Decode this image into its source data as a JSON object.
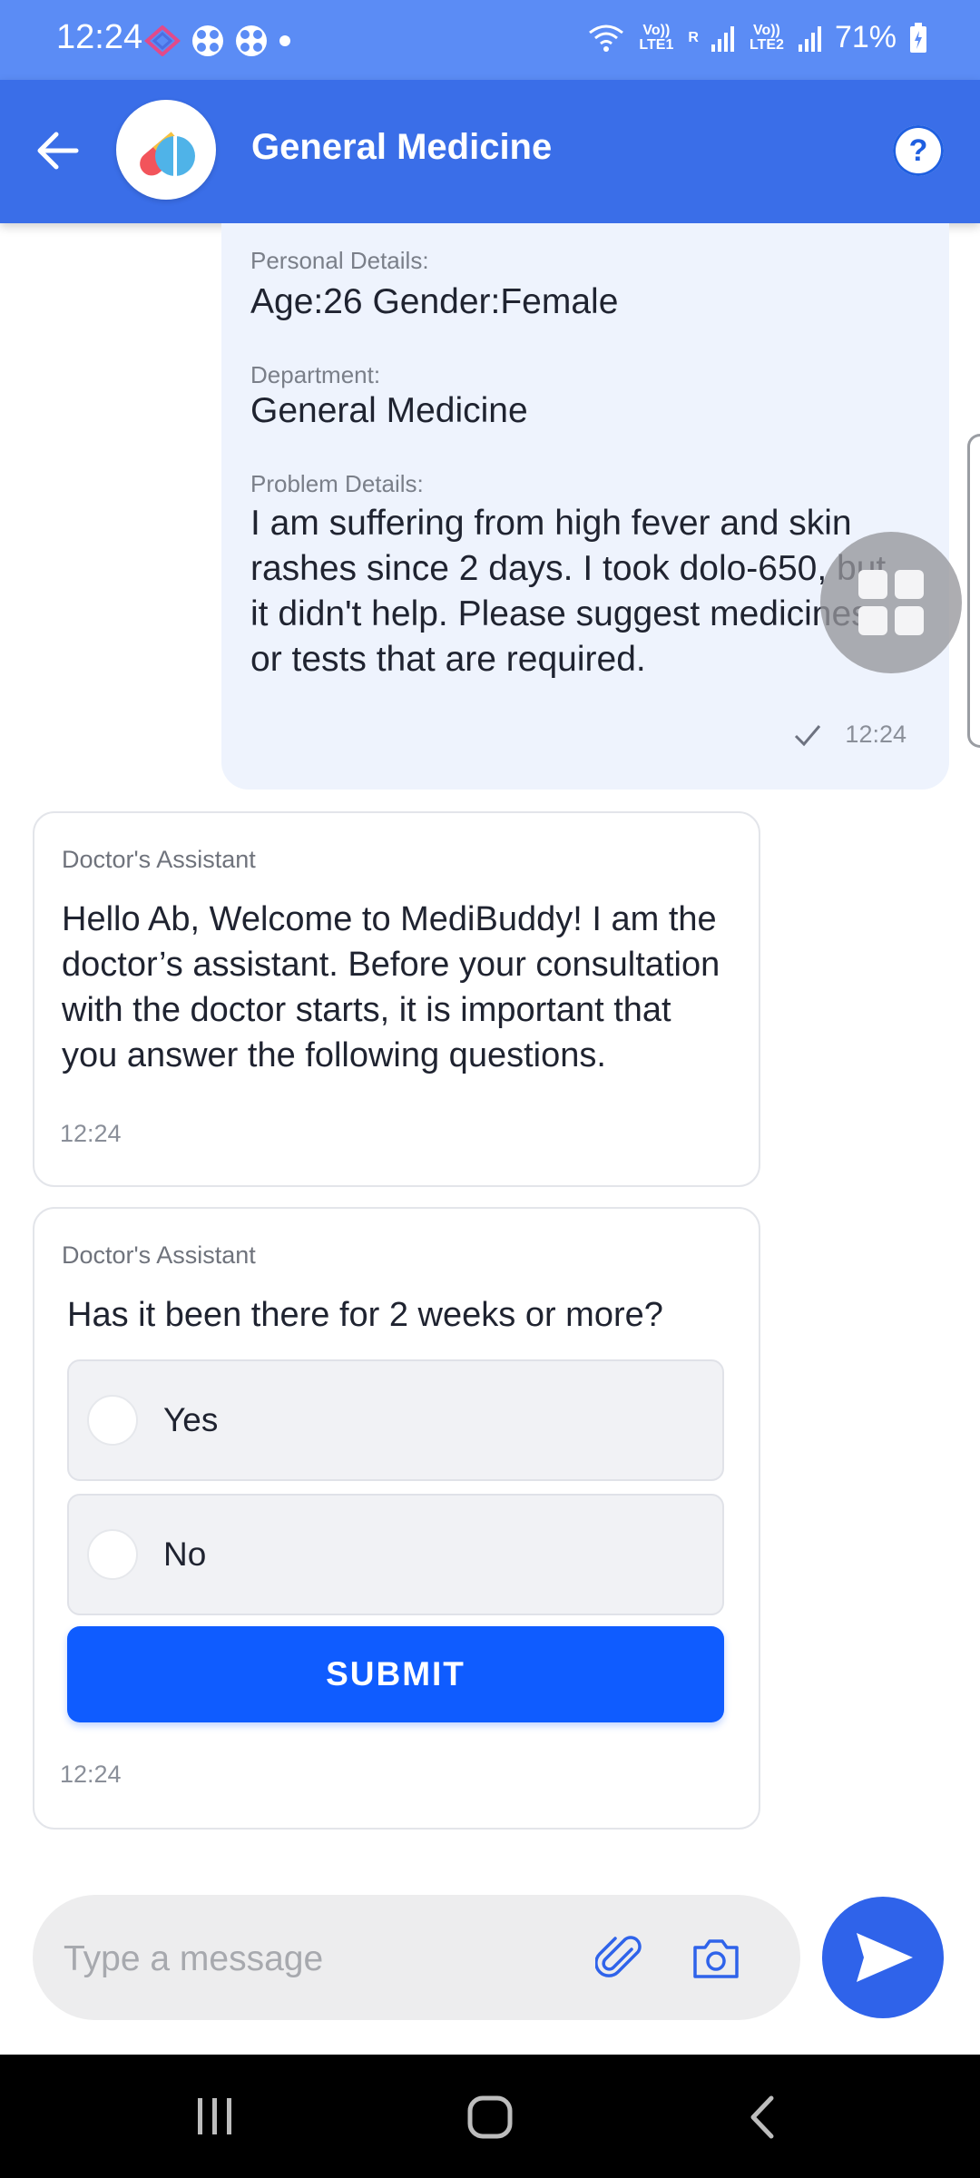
{
  "status_bar": {
    "time": "12:24",
    "battery": "71%",
    "network_1": "Vo)) LTE1",
    "network_2": "Vo)) LTE2",
    "roaming": "R"
  },
  "app_bar": {
    "title": "General Medicine",
    "help_label": "?"
  },
  "user_message": {
    "personal_label": "Personal Details:",
    "personal_value": "Age:26 Gender:Female",
    "department_label": "Department:",
    "department_value": "General Medicine",
    "problem_label": "Problem Details:",
    "problem_value": "I am suffering from high fever and skin rashes since 2 days. I took dolo-650, but it didn't help. Please suggest medicines or tests that are required.",
    "time": "12:24"
  },
  "assistant_message_1": {
    "sender": "Doctor's Assistant",
    "text": "Hello Ab, Welcome to MediBuddy! I am the doctor’s assistant. Before your consultation with the doctor starts, it is important that you answer the following questions.",
    "time": "12:24"
  },
  "assistant_message_2": {
    "sender": "Doctor's Assistant",
    "question": "Has it been there for 2 weeks or more?",
    "options": [
      "Yes",
      "No"
    ],
    "submit_label": "SUBMIT",
    "time": "12:24"
  },
  "composer": {
    "placeholder": "Type a message"
  },
  "colors": {
    "app_bar": "#3a6ee8",
    "status_bar": "#5b8cf5",
    "accent": "#0f5cff",
    "bubble": "#eef3fd"
  },
  "icons": {
    "back": "arrow-left-icon",
    "help": "question-icon",
    "attach": "paperclip-icon",
    "camera": "camera-icon",
    "send": "send-icon",
    "check": "check-icon",
    "widget": "grid-icon"
  }
}
